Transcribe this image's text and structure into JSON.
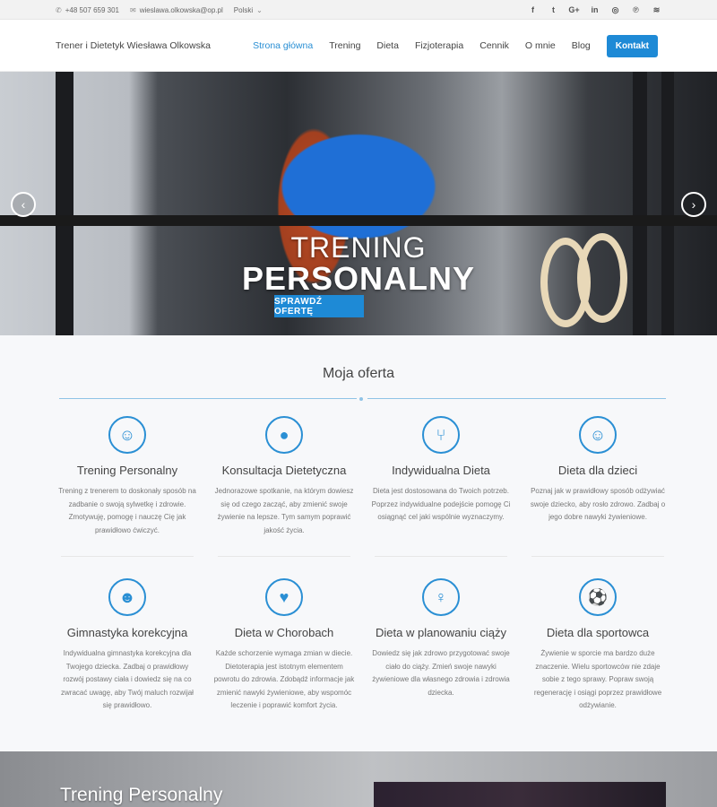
{
  "topbar": {
    "phone": "+48 507 659 301",
    "email": "wieslawa.olkowska@op.pl",
    "language": "Polski",
    "social_icons": [
      "facebook-icon",
      "twitter-icon",
      "google-plus-icon",
      "linkedin-icon",
      "instagram-icon",
      "pinterest-icon",
      "rss-icon"
    ],
    "social_glyphs": [
      "f",
      "t",
      "G+",
      "in",
      "◎",
      "℗",
      "≋"
    ]
  },
  "nav": {
    "brand": "Trener i Dietetyk Wiesława Olkowska",
    "items": [
      "Strona główna",
      "Trening",
      "Dieta",
      "Fizjoterapia",
      "Cennik",
      "O mnie",
      "Blog"
    ],
    "cta": "Kontakt"
  },
  "hero": {
    "line1": "TRENING",
    "line2": "PERSONALNY",
    "button": "SPRAWDŹ OFERTĘ",
    "prev_glyph": "‹",
    "next_glyph": "›"
  },
  "offer": {
    "title": "Moja oferta",
    "cards": [
      {
        "icon": "person-icon",
        "glyph": "☺",
        "title": "Trening Personalny",
        "text": "Trening z trenerem to doskonały sposób na zadbanie o swoją sylwetkę i zdrowie. Zmotywuję, pomogę i nauczę Cię jak prawidłowo ćwiczyć."
      },
      {
        "icon": "chat-bubble-icon",
        "glyph": "●",
        "title": "Konsultacja Dietetyczna",
        "text": "Jednorazowe spotkanie, na którym dowiesz się od czego zacząć, aby zmienić swoje żywienie na lepsze. Tym samym poprawić jakość życia."
      },
      {
        "icon": "fork-knife-icon",
        "glyph": "⑂",
        "title": "Indywidualna Dieta",
        "text": "Dieta jest dostosowana do Twoich potrzeb. Poprzez indywidualne podejście pomogę Ci osiągnąć cel jaki wspólnie wyznaczymy."
      },
      {
        "icon": "child-icon",
        "glyph": "☺",
        "title": "Dieta dla dzieci",
        "text": "Poznaj jak w prawidłowy sposób odżywiać swoje dziecko, aby rosło zdrowo. Zadbaj o jego dobre nawyki żywieniowe."
      },
      {
        "icon": "child-face-icon",
        "glyph": "☻",
        "title": "Gimnastyka korekcyjna",
        "text": "Indywidualna gimnastyka korekcyjna dla Twojego dziecka. Zadbaj o prawidłowy rozwój postawy ciała i dowiedz się na co zwracać uwagę, aby Twój maluch rozwijał się prawidłowo."
      },
      {
        "icon": "heartbeat-icon",
        "glyph": "♥",
        "title": "Dieta w Chorobach",
        "text": "Każde schorzenie wymaga zmian w diecie. Dietoterapia jest istotnym elementem powrotu do zdrowia. Zdobądź informacje jak zmienić nawyki żywieniowe, aby wspomóc leczenie i poprawić komfort życia."
      },
      {
        "icon": "pregnant-icon",
        "glyph": "♀",
        "title": "Dieta w planowaniu ciąży",
        "text": "Dowiedz się jak zdrowo przygotować swoje ciało do ciąży. Zmień swoje nawyki żywieniowe dla własnego zdrowia i zdrowia dziecka."
      },
      {
        "icon": "soccer-ball-icon",
        "glyph": "⚽",
        "title": "Dieta dla sportowca",
        "text": "Żywienie w sporcie ma bardzo duże znaczenie. Wielu sportowców nie zdaje sobie z tego sprawy. Popraw swoją regenerację i osiągi poprzez prawidłowe odżywianie."
      }
    ]
  },
  "bottom": {
    "title": "Trening Personalny"
  },
  "colors": {
    "accent": "#1e8ad6",
    "text": "#444444"
  }
}
